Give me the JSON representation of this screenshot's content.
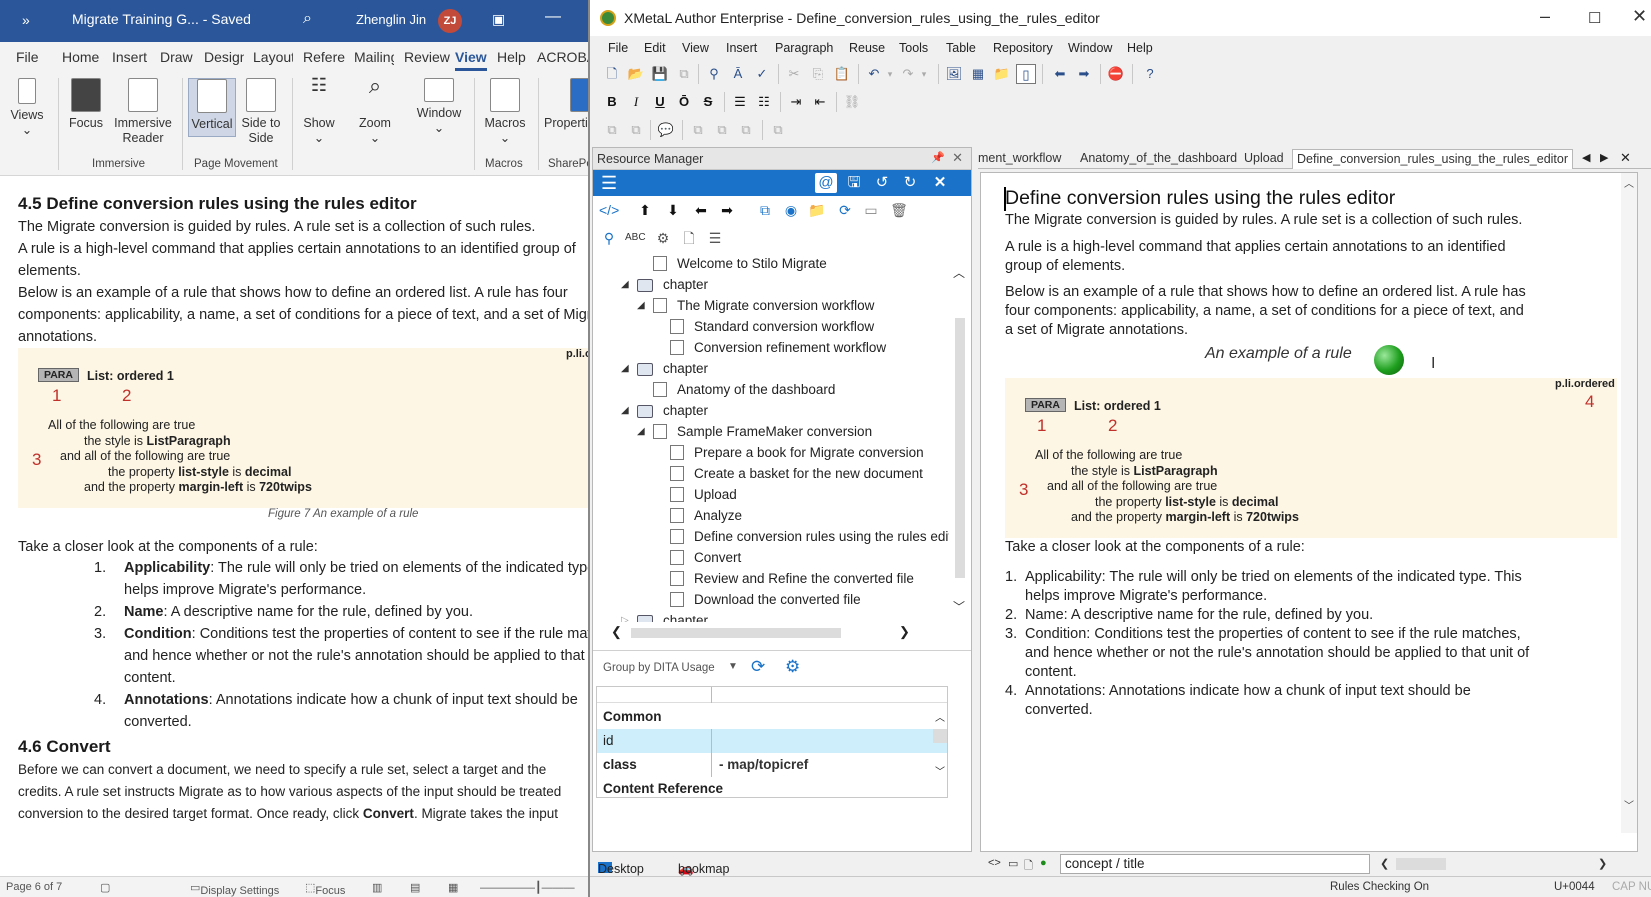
{
  "word": {
    "title_bar": {
      "expand": "»",
      "document_title": "Migrate Training G... - Saved",
      "user_name": "Zhenglin Jin",
      "avatar_initials": "ZJ"
    },
    "tabs": [
      "File",
      "Home",
      "Insert",
      "Draw",
      "Design",
      "Layout",
      "References",
      "Mailings",
      "Review",
      "View",
      "Help",
      "ACROBAT"
    ],
    "active_tab": "View",
    "ribbon": {
      "views": "Views",
      "focus": "Focus",
      "immersive_reader": "Immersive Reader",
      "vertical": "Vertical",
      "side_to_side": "Side to Side",
      "show": "Show",
      "zoom": "Zoom",
      "window": "Window",
      "macros": "Macros",
      "properties": "Properties",
      "group_immersive": "Immersive",
      "group_page_movement": "Page Movement",
      "group_macros": "Macros",
      "group_sharepoint": "SharePoint"
    },
    "doc": {
      "heading_45": "4.5 Define conversion rules using the rules editor",
      "p1": "The Migrate conversion is guided by rules.  A rule set is a collection of such rules.",
      "p2a": "A rule is a high-level command that applies certain annotations to an identified group of",
      "p2b": "elements.",
      "p3a": "Below is an example of a rule that shows how to define an ordered list. A rule has four",
      "p3b": "components: applicability, a name, a set of conditions for a piece of text, and a set of Migrate",
      "p3c": "annotations.",
      "figure": {
        "right_tag": "p.li.ordered",
        "para_tag": "PARA",
        "rule_title": "List: ordered 1",
        "num1": "1",
        "num2": "2",
        "num3": "3",
        "line1": "All of the following are true",
        "line2_a": "the style is ",
        "line2_b": "ListParagraph",
        "line3": "and all of the following are true",
        "line4_a": "the property ",
        "line4_b": "list-style",
        "line4_c": " is ",
        "line4_d": "decimal",
        "line5_a": "and the property ",
        "line5_b": "margin-left",
        "line5_c": " is ",
        "line5_d": "720twips"
      },
      "caption": "Figure 7 An example of a rule",
      "closer_look": "Take a closer look at the components of a rule:",
      "list": [
        {
          "num": "1.",
          "bold": "Applicability",
          "text": ": The rule will only be tried on elements of the indicated type. This",
          "text2": "helps improve Migrate's performance."
        },
        {
          "num": "2.",
          "bold": "Name",
          "text": ": A descriptive name for the rule, defined by you.",
          "text2": ""
        },
        {
          "num": "3.",
          "bold": "Condition",
          "text": ": Conditions test the properties of content to see if the rule matches,",
          "text2": "and hence whether or not the rule's annotation should be applied to that unit of",
          "text3": "content."
        },
        {
          "num": "4.",
          "bold": "Annotations",
          "text": ": Annotations indicate how a chunk of input text should be",
          "text2": "converted."
        }
      ],
      "heading_46": "4.6 Convert",
      "p4a": "Before we can convert a document, we need to specify a rule set, select a target and the",
      "p4b": "credits. A rule set instructs Migrate as to how various aspects of the input should be treated",
      "p4c_a": "conversion to the desired target format. Once ready, click ",
      "p4c_b": "Convert",
      "p4c_c": ". Migrate takes the input"
    },
    "status": {
      "page": "Page 6 of 7",
      "display_settings": "Display Settings",
      "focus": "Focus"
    }
  },
  "xmetal": {
    "title": "XMetaL Author Enterprise - Define_conversion_rules_using_the_rules_editor",
    "menu": [
      "File",
      "Edit",
      "View",
      "Insert",
      "Paragraph",
      "Reuse",
      "Tools",
      "Table",
      "Repository",
      "Window",
      "Help"
    ],
    "resource_manager": {
      "title": "Resource Manager",
      "tree": [
        {
          "label": "Welcome to Stilo Migrate",
          "level": 2,
          "type": "topic",
          "twisty": ""
        },
        {
          "label": "chapter",
          "level": 1,
          "type": "book",
          "twisty": "◢"
        },
        {
          "label": "The Migrate conversion workflow",
          "level": 2,
          "type": "topic",
          "twisty": "◢"
        },
        {
          "label": "Standard conversion workflow",
          "level": 3,
          "type": "topic",
          "twisty": ""
        },
        {
          "label": "Conversion refinement workflow",
          "level": 3,
          "type": "topic",
          "twisty": ""
        },
        {
          "label": "chapter",
          "level": 1,
          "type": "book",
          "twisty": "◢"
        },
        {
          "label": "Anatomy of the dashboard",
          "level": 2,
          "type": "topic",
          "twisty": ""
        },
        {
          "label": "chapter",
          "level": 1,
          "type": "book",
          "twisty": "◢"
        },
        {
          "label": "Sample FrameMaker conversion",
          "level": 2,
          "type": "topic",
          "twisty": "◢"
        },
        {
          "label": "Prepare a book for Migrate conversion",
          "level": 3,
          "type": "topic",
          "twisty": ""
        },
        {
          "label": "Create a basket for the new document",
          "level": 3,
          "type": "topic",
          "twisty": ""
        },
        {
          "label": "Upload",
          "level": 3,
          "type": "topic",
          "twisty": ""
        },
        {
          "label": "Analyze",
          "level": 3,
          "type": "topic",
          "twisty": ""
        },
        {
          "label": "Define conversion rules using the rules editor",
          "level": 3,
          "type": "topic",
          "twisty": ""
        },
        {
          "label": "Convert",
          "level": 3,
          "type": "topic",
          "twisty": ""
        },
        {
          "label": "Review and Refine the converted file",
          "level": 3,
          "type": "topic",
          "twisty": ""
        },
        {
          "label": "Download the converted file",
          "level": 3,
          "type": "topic",
          "twisty": ""
        },
        {
          "label": "chapter",
          "level": 1,
          "type": "book",
          "twisty": "▷"
        }
      ],
      "group_by": "Group by DITA Usage",
      "properties": {
        "group_common": "Common",
        "id_key": "id",
        "id_value": "",
        "class_key": "class",
        "class_value": "- map/topicref",
        "group_content_ref": "Content Reference"
      },
      "bottom_tabs": [
        "Desktop",
        "bookmap"
      ]
    },
    "editor": {
      "tabs": [
        "ment_workflow",
        "Anatomy_of_the_dashboard",
        "Upload",
        "Define_conversion_rules_using_the_rules_editor"
      ],
      "title": "Define conversion rules using the rules editor",
      "p1": "The Migrate conversion is guided by rules. A rule set is a collection of such rules.",
      "p2a": "A rule is a high-level command that applies certain annotations to an identified",
      "p2b": "group of elements.",
      "p3a": "Below is an example of a rule that shows how to define an ordered list. A rule has",
      "p3b": "four components: applicability, a name, a set of conditions for a piece of text, and",
      "p3c": "a set of Migrate annotations.",
      "fig_caption": "An example of a rule",
      "figure": {
        "right_tag": "p.li.ordered",
        "num4": "4"
      },
      "closer_look": "Take a closer look at the components of a rule:",
      "list": [
        {
          "num": "1.",
          "text": "Applicability: The rule will only be tried on elements of the indicated type. This",
          "text2": "helps improve Migrate's performance."
        },
        {
          "num": "2.",
          "text": "Name: A descriptive name for the rule, defined by you.",
          "text2": ""
        },
        {
          "num": "3.",
          "text": "Condition: Conditions test the properties of content to see if the rule matches,",
          "text2": "and hence whether or not the rule's annotation should be applied to that unit of",
          "text3": "content."
        },
        {
          "num": "4.",
          "text": "Annotations: Annotations indicate how a chunk of input text should be",
          "text2": "converted."
        }
      ],
      "element_path": "concept / title"
    },
    "status": {
      "rules": "Rules Checking On",
      "unicode": "U+0044",
      "keys": "CAP  NUM  SCRL"
    }
  }
}
